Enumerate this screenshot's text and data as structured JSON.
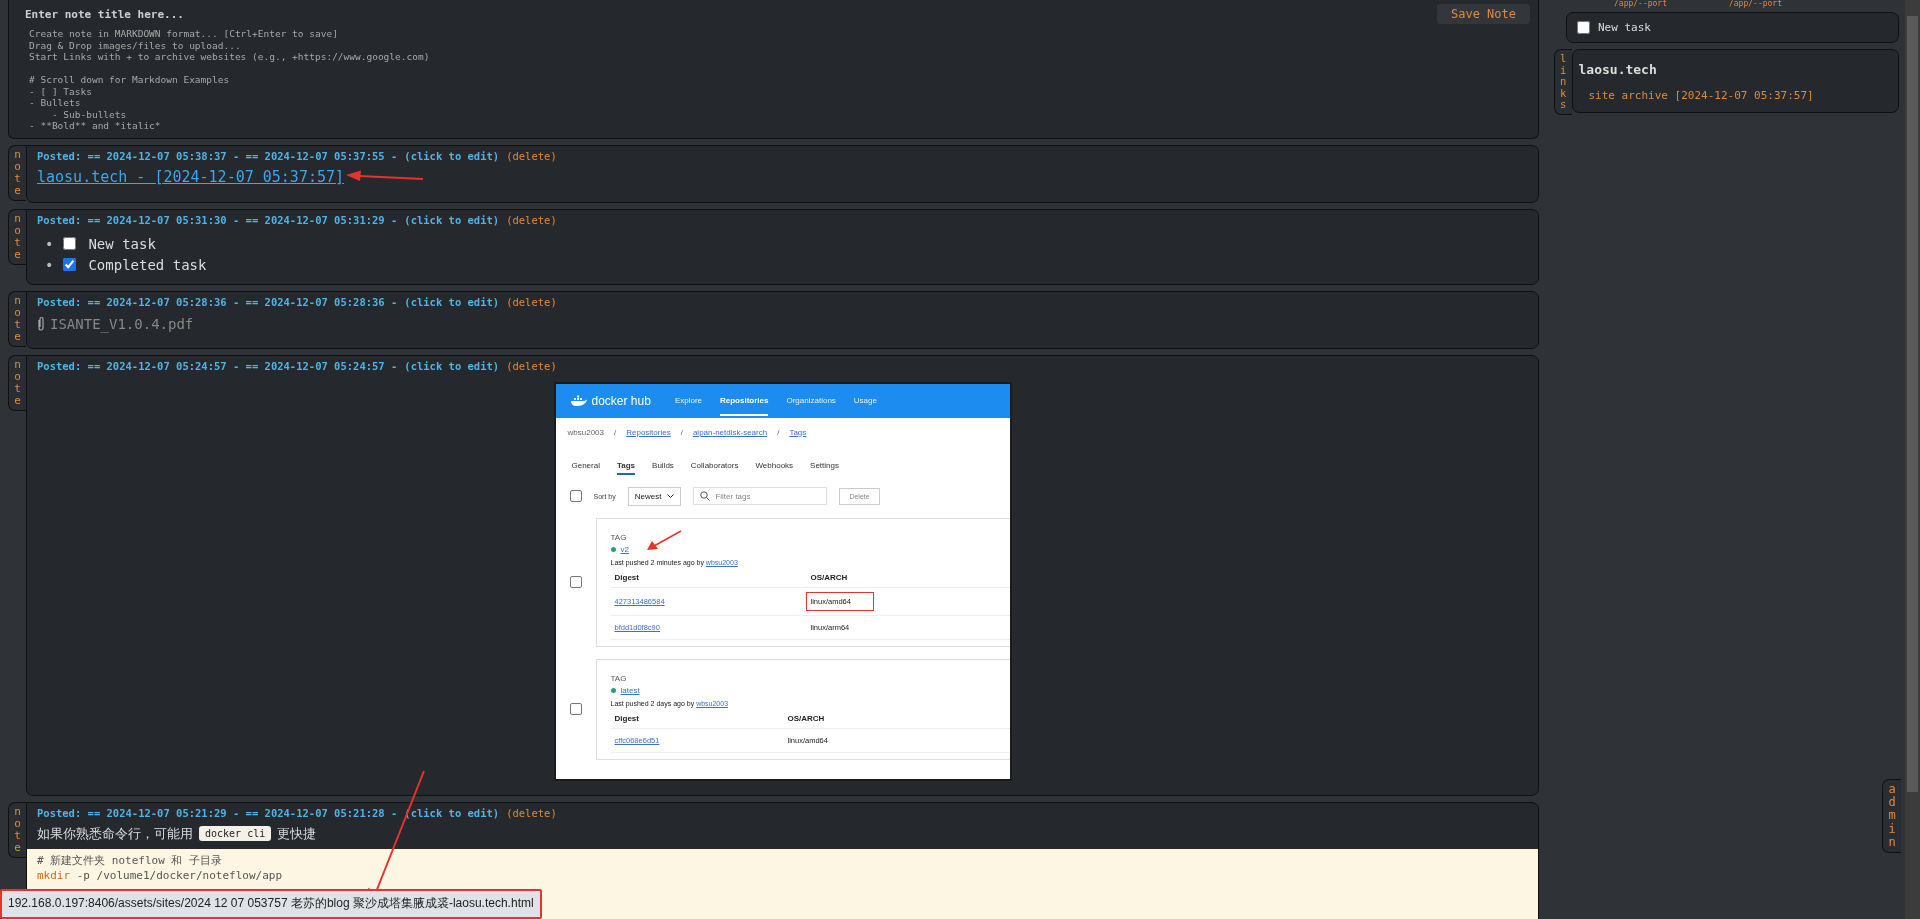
{
  "editor": {
    "title_placeholder": "Enter note title here...",
    "body_placeholder": "Create note in MARKDOWN format... [Ctrl+Enter to save]\nDrag & Drop images/files to upload...\nStart Links with + to archive websites (e.g., +https://www.google.com)\n\n# Scroll down for Markdown Examples\n- [ ] Tasks\n- Bullets\n    - Sub-bullets\n- **Bold** and *italic*",
    "save_button": "Save Note"
  },
  "notes": [
    {
      "tab": "note",
      "kind": "link",
      "posted": "Posted: == 2024-12-07 05:38:37 - == 2024-12-07 05:37:55 -",
      "edit": "(click to edit)",
      "delete": "(delete)",
      "link": "laosu.tech - [2024-12-07 05:37:57]"
    },
    {
      "tab": "note",
      "kind": "tasks",
      "posted": "Posted: == 2024-12-07 05:31:30 - == 2024-12-07 05:31:29 -",
      "edit": "(click to edit)",
      "delete": "(delete)",
      "tasks": [
        {
          "bullet": "•",
          "label": "New task",
          "checked": false
        },
        {
          "bullet": "•",
          "label": "Completed task",
          "checked": true
        }
      ]
    },
    {
      "tab": "note",
      "kind": "file",
      "posted": "Posted: == 2024-12-07 05:28:36 - == 2024-12-07 05:28:36 -",
      "edit": "(click to edit)",
      "delete": "(delete)",
      "file": "ISANTE_V1.0.4.pdf"
    },
    {
      "tab": "note",
      "kind": "image",
      "posted": "Posted: == 2024-12-07 05:24:57 - == 2024-12-07 05:24:57 -",
      "edit": "(click to edit)",
      "delete": "(delete)"
    },
    {
      "tab": "note",
      "kind": "code",
      "posted": "Posted: == 2024-12-07 05:21:29 - == 2024-12-07 05:21:28 -",
      "edit": "(click to edit)",
      "delete": "(delete)",
      "text_before": "如果你熟悉命令行，可能用",
      "inline_code": "docker cli",
      "text_after": "更快捷",
      "code_comment": "# 新建文件夹 noteflow 和 子目录",
      "code_command": "mkdir",
      "code_args": " -p /volume1/docker/noteflow/app"
    }
  ],
  "docker": {
    "logo": "docker hub",
    "nav": [
      {
        "label": "Explore",
        "selected": false
      },
      {
        "label": "Repositories",
        "selected": true
      },
      {
        "label": "Organizations",
        "selected": false
      },
      {
        "label": "Usage",
        "selected": false
      }
    ],
    "breadcrumb": [
      "wbsu2003",
      "Repositories",
      "aipan-netdisk-search",
      "Tags"
    ],
    "breadcrumb_separator": "/",
    "select_all_checked": false,
    "tabs": [
      {
        "label": "General",
        "selected": false
      },
      {
        "label": "Tags",
        "selected": true
      },
      {
        "label": "Builds",
        "selected": false
      },
      {
        "label": "Collaborators",
        "selected": false
      },
      {
        "label": "Webhooks",
        "selected": false
      },
      {
        "label": "Settings",
        "selected": false
      }
    ],
    "sort_label": "Sort by",
    "sort_value": "Newest",
    "filter_placeholder": "Filter tags",
    "delete_button": "Delete",
    "tags": [
      {
        "label": "TAG",
        "checked": false,
        "name": "v2",
        "pushed": "Last pushed 2 minutes ago by",
        "user": "wbsu2003",
        "col_digest": "Digest",
        "col_os": "OS/ARCH",
        "rows": [
          {
            "digest": "427313486584",
            "os": "linux/amd64",
            "highlighted": true
          },
          {
            "digest": "bfdd1d0f8c90",
            "os": "linux/arm64",
            "highlighted": false
          }
        ]
      },
      {
        "label": "TAG",
        "checked": false,
        "name": "latest",
        "pushed": "Last pushed 2 days ago by",
        "user": "wbsu2003",
        "col_digest": "Digest",
        "col_os": "OS/ARCH",
        "rows": [
          {
            "digest": "cffc068e6d51",
            "os": "linux/amd64",
            "highlighted": false
          }
        ]
      }
    ]
  },
  "sidebar": {
    "top_labels": [
      "/app/--port",
      "/app/--port"
    ],
    "task": {
      "label": "New task",
      "checked": false
    },
    "links_tab": "links",
    "links_title": "laosu.tech",
    "link_item": "site archive [2024-12-07 05:37:57]",
    "admin_tab": "admin"
  },
  "status_bar": "192.168.0.197:8406/assets/sites/2024 12 07 053757 老苏的blog 聚沙成塔集腋成裘-laosu.tech.html"
}
